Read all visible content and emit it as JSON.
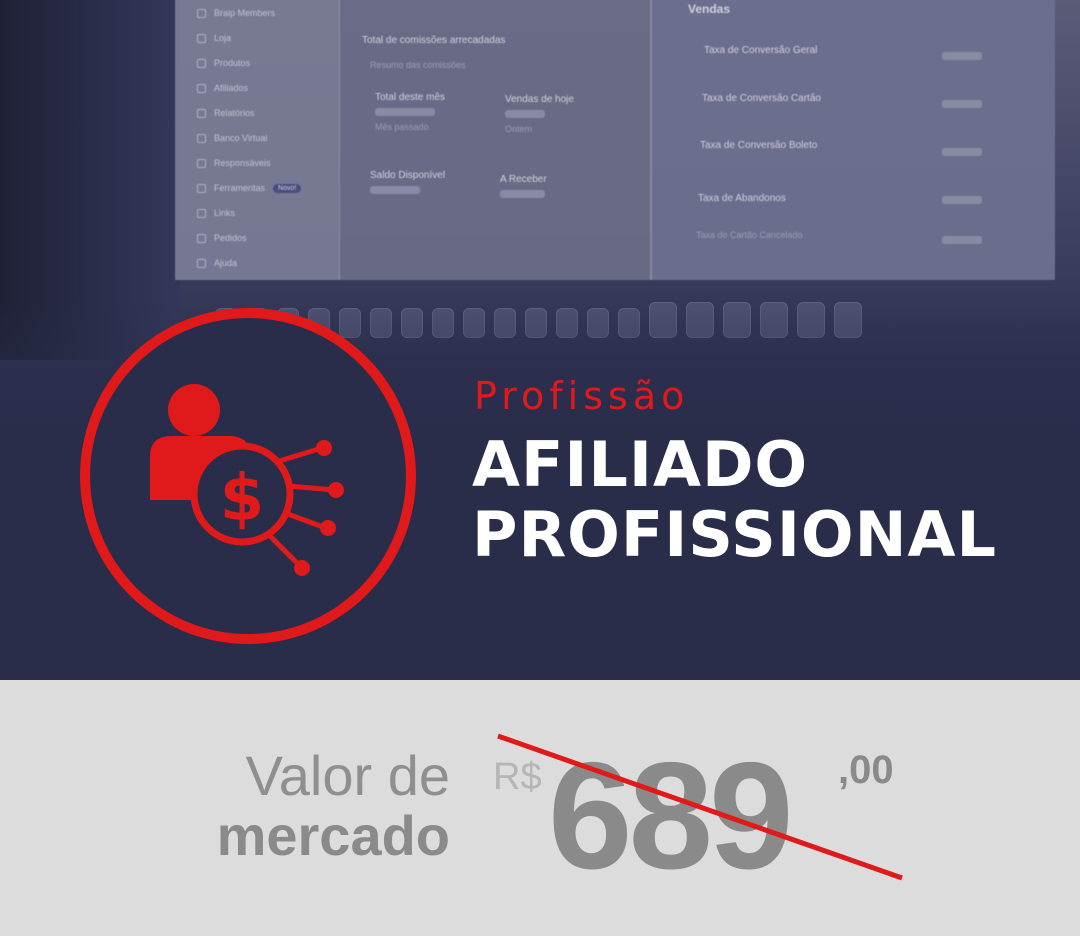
{
  "screen": {
    "sidebar": {
      "items": [
        {
          "label": "Braip Members",
          "icon": "star-icon"
        },
        {
          "label": "Loja",
          "icon": "grid-icon"
        },
        {
          "label": "Produtos",
          "icon": "box-icon"
        },
        {
          "label": "Afiliados",
          "icon": "people-icon"
        },
        {
          "label": "Relatórios",
          "icon": "chart-icon"
        },
        {
          "label": "Banco Virtual",
          "icon": "bank-icon"
        },
        {
          "label": "Responsáveis",
          "icon": "list-icon"
        },
        {
          "label": "Ferramentas",
          "icon": "tools-icon",
          "badge": "Novo!"
        },
        {
          "label": "Links",
          "icon": "link-icon"
        },
        {
          "label": "Pedidos",
          "icon": "order-icon"
        },
        {
          "label": "Ajuda",
          "icon": "help-icon"
        }
      ]
    },
    "main": {
      "commissions_title": "Total de comissões arrecadadas",
      "commissions_sub": "Resumo das comissões",
      "month_total": "Total deste mês",
      "month_sub": "Mês passado",
      "today_sales": "Vendas de hoje",
      "today_sub": "Ontem",
      "balance": "Saldo Disponível",
      "receivable": "A Receber"
    },
    "right": {
      "title": "Vendas",
      "rows": [
        "Taxa de Conversão Geral",
        "Taxa de Conversão Cartão",
        "Taxa de Conversão Boleto",
        "Taxa de Abandonos",
        "Taxa de Cartão Cancelado"
      ]
    }
  },
  "badge": {
    "icon": "affiliate-money-network-icon",
    "accent": "#e01a1a"
  },
  "hero": {
    "kicker": "Profissão",
    "title_line1": "AFILIADO",
    "title_line2": "PROFISSIONAL"
  },
  "price": {
    "label_line1": "Valor de",
    "label_line2": "mercado",
    "currency": "R$",
    "amount": "689",
    "cents": ",00",
    "struck": true
  },
  "colors": {
    "background_dark": "#2a2d4a",
    "accent_red": "#e01a1a",
    "price_gray": "#8a8a8a",
    "strip_bg": "#dcdcdc"
  }
}
